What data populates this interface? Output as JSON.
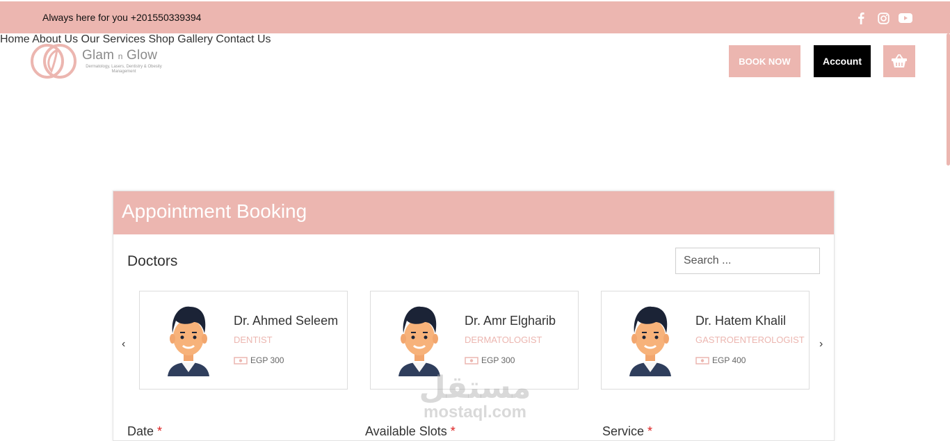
{
  "topbar": {
    "phone_text": "Always here for you +201550339394",
    "socials": [
      "facebook-icon",
      "instagram-icon",
      "youtube-icon"
    ]
  },
  "brand": {
    "title_main": "Glam",
    "title_n": "n",
    "title_end": "Glow",
    "subtitle": "Dermatology, Lasers, Dentistry & Obesity Management"
  },
  "nav": {
    "items": [
      "Home",
      "About Us",
      "Our Services",
      "Shop",
      "Gallery",
      "Contact Us"
    ],
    "book_label": "BOOK NOW",
    "account_label": "Account"
  },
  "booking": {
    "title": "Appointment Booking",
    "doctors_label": "Doctors",
    "search_placeholder": "Search ...",
    "doctors": [
      {
        "name": "Dr. Ahmed Seleem",
        "specialty": "DENTIST",
        "fee": "EGP 300"
      },
      {
        "name": "Dr. Amr Elgharib",
        "specialty": "DERMATOLOGIST",
        "fee": "EGP 300"
      },
      {
        "name": "Dr. Hatem Khalil",
        "specialty": "GASTROENTEROLOGIST",
        "fee": "EGP 400"
      }
    ],
    "fields": [
      {
        "label": "Date",
        "required": "*"
      },
      {
        "label": "Available Slots",
        "required": "*"
      },
      {
        "label": "Service",
        "required": "*"
      }
    ]
  },
  "watermark": {
    "arabic": "مستقل",
    "latin": "mostaql.com"
  },
  "colors": {
    "accent": "#ecb6b0",
    "account_bg": "#000000",
    "required": "#dd2222"
  }
}
